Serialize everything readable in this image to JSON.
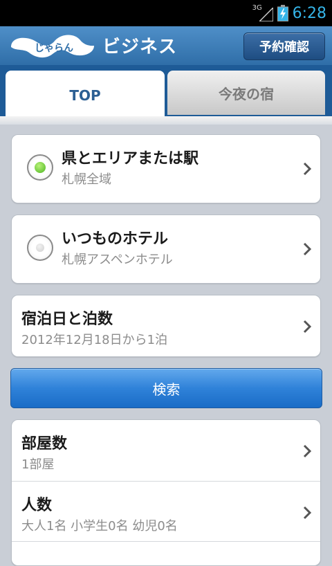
{
  "status": {
    "network": "3G",
    "time": "6:28"
  },
  "header": {
    "logo_text": "じゃらん",
    "title": "ビジネス",
    "reserve_button": "予約確認"
  },
  "tabs": [
    {
      "label": "TOP"
    },
    {
      "label": "今夜の宿"
    }
  ],
  "selection": {
    "area": {
      "title": "県とエリアまたは駅",
      "value": "札幌全域",
      "selected": true
    },
    "hotel": {
      "title": "いつものホテル",
      "value": "札幌アスペンホテル",
      "selected": false
    }
  },
  "stay": {
    "title": "宿泊日と泊数",
    "value": "2012年12月18日から1泊"
  },
  "search_button": "検索",
  "options": {
    "rooms": {
      "title": "部屋数",
      "value": "1部屋"
    },
    "people": {
      "title": "人数",
      "value": "大人1名 小学生0名 幼児0名"
    }
  },
  "colors": {
    "header": "#2f6ea8",
    "tab_bar": "#1e5b97",
    "accent_text": "#2c5f93",
    "search_button": "#2f82d9",
    "status_text": "#35b4e8"
  }
}
